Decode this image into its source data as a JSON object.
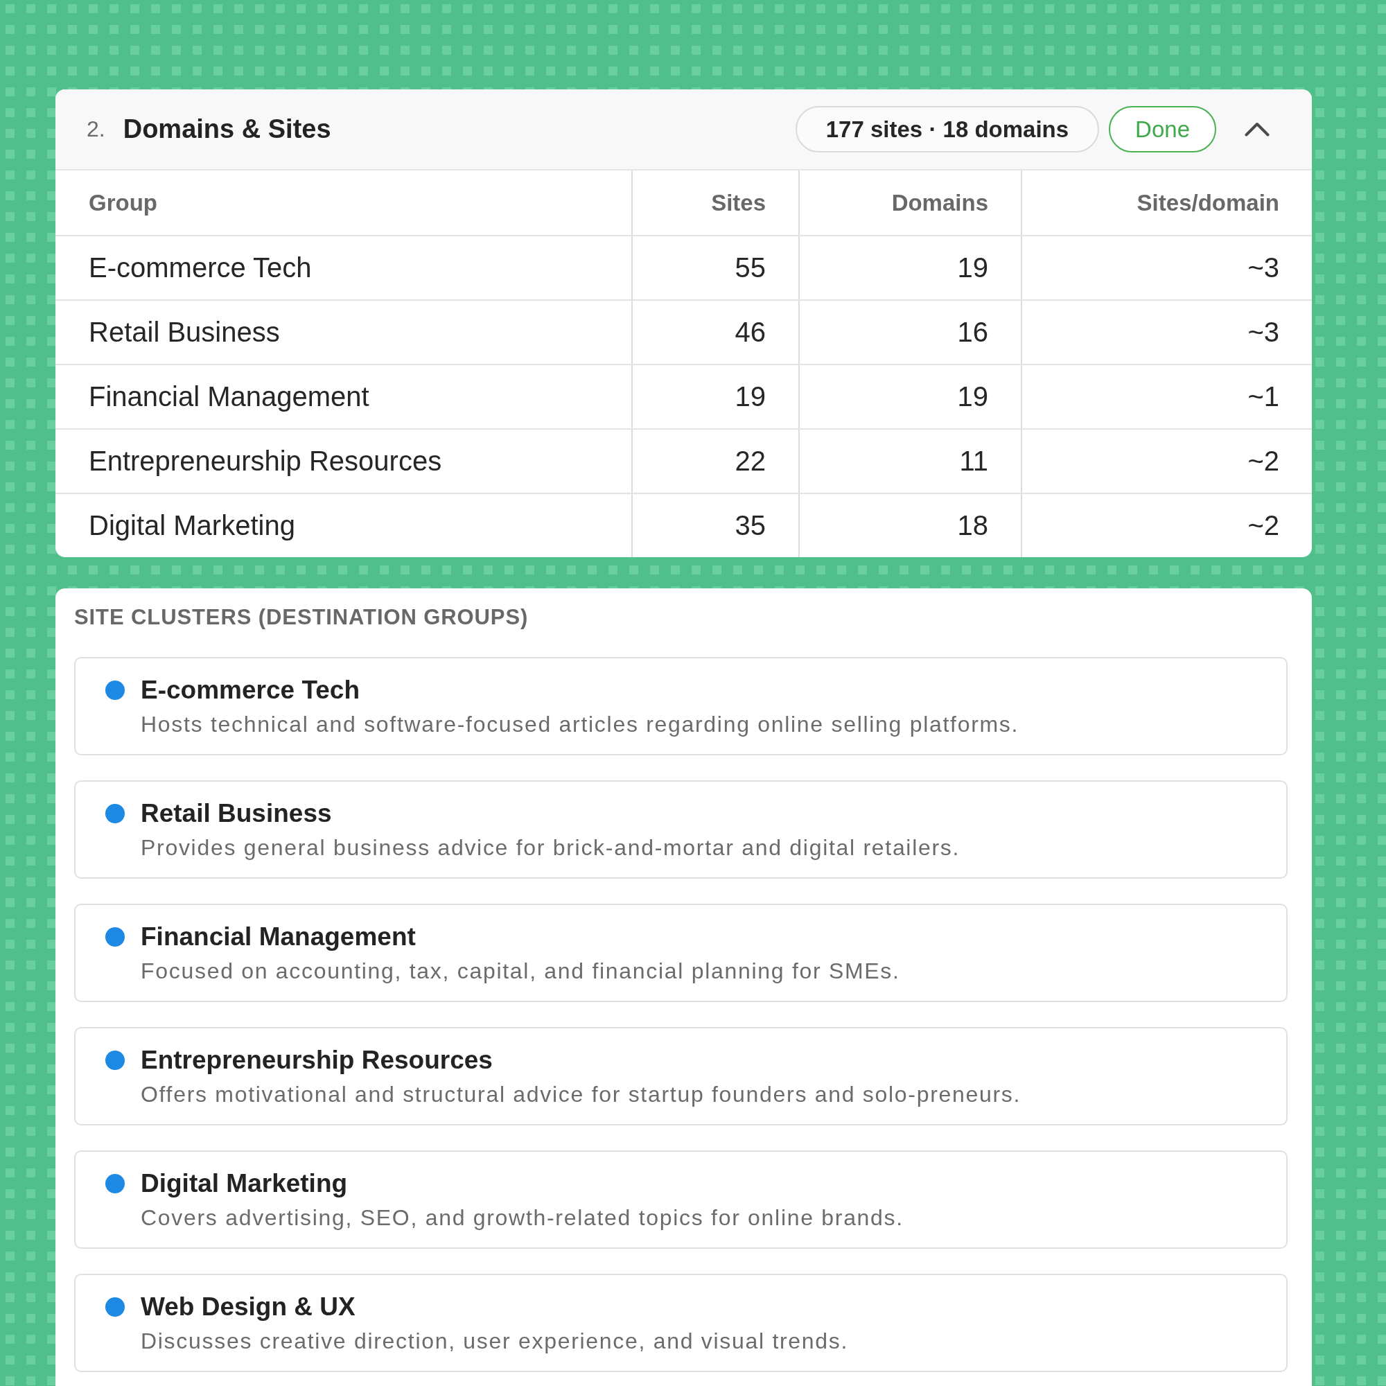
{
  "section": {
    "number": "2.",
    "title": "Domains & Sites",
    "summary": "177 sites · 18 domains",
    "status_button": "Done",
    "expanded": true
  },
  "table": {
    "columns": [
      "Group",
      "Sites",
      "Domains",
      "Sites/domain"
    ],
    "rows": [
      [
        "E-commerce Tech",
        "55",
        "19",
        "~3"
      ],
      [
        "Retail Business",
        "46",
        "16",
        "~3"
      ],
      [
        "Financial Management",
        "19",
        "19",
        "~1"
      ],
      [
        "Entrepreneurship Resources",
        "22",
        "11",
        "~2"
      ],
      [
        "Digital Marketing",
        "35",
        "18",
        "~2"
      ]
    ]
  },
  "clusters": {
    "heading": "SITE CLUSTERS (DESTINATION GROUPS)",
    "items": [
      {
        "name": "E-commerce Tech",
        "description": "Hosts technical and software-focused articles regarding online selling platforms."
      },
      {
        "name": "Retail Business",
        "description": "Provides general business advice for brick-and-mortar and digital retailers."
      },
      {
        "name": "Financial Management",
        "description": "Focused on accounting, tax, capital, and financial planning for SMEs."
      },
      {
        "name": "Entrepreneurship Resources",
        "description": "Offers motivational and structural advice for startup founders and solo-preneurs."
      },
      {
        "name": "Digital Marketing",
        "description": "Covers advertising, SEO, and growth-related topics for online brands."
      },
      {
        "name": "Web Design & UX",
        "description": "Discusses creative direction, user experience, and visual trends."
      }
    ]
  }
}
